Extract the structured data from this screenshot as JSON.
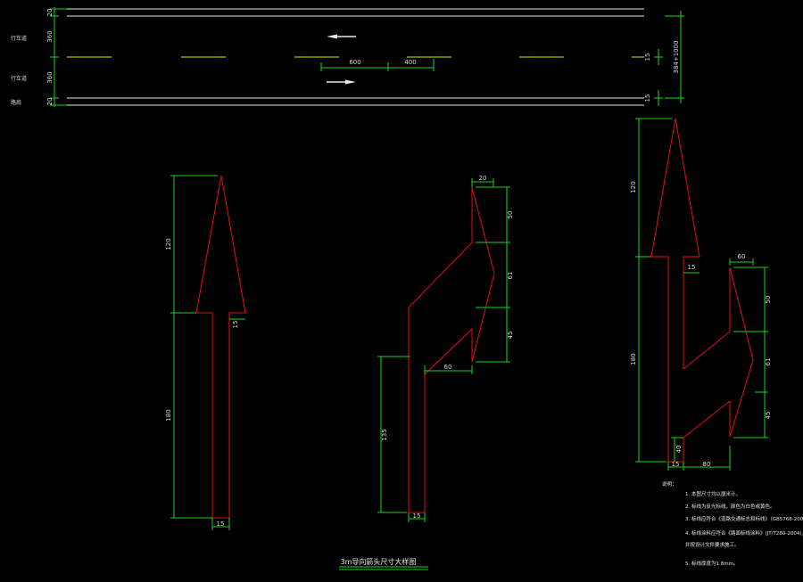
{
  "colors": {
    "background": "#000000",
    "road_line": "#e8e8e8",
    "lane_dash": "#e6e600",
    "arrow_outline": "#e01010",
    "dimension": "#19d619"
  },
  "road": {
    "left_labels": [
      "行车道",
      "行车道",
      "路肩"
    ],
    "left_dims": [
      "20",
      "360",
      "360",
      "20"
    ],
    "dash_dims": [
      "600",
      "400"
    ],
    "right_dims": [
      "15",
      "15"
    ],
    "total_width": "384+1000"
  },
  "arrow_straight": {
    "dims": [
      "120",
      "180",
      "15",
      "15"
    ]
  },
  "arrow_turn": {
    "dims": [
      "20",
      "50",
      "61",
      "45",
      "60",
      "135",
      "15"
    ]
  },
  "arrow_combo": {
    "dims": [
      "120",
      "180",
      "15",
      "60",
      "50",
      "61",
      "45",
      "40",
      "15",
      "80"
    ]
  },
  "notes": {
    "heading": "说明：",
    "items": [
      "1. 本图尺寸均以厘米计。",
      "2. 标线为反光标线，颜色为白色或黄色。",
      "3. 标线应符合《道路交通标志和标线》（GB5768-2009）。",
      "4. 标线涂料应符合《路面标线涂料》(JT/T280-2004)，",
      "   并按设计文件要求施工。",
      "5. 标线厚度为1.8mm。"
    ]
  },
  "drawing_title": "3m导向箭头尺寸大样图"
}
